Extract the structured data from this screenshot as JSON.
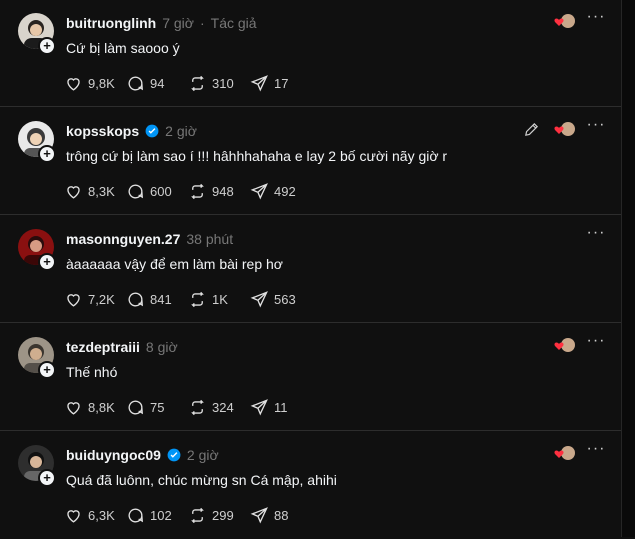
{
  "colors": {
    "background": "#101010",
    "text": "#f3f5f7",
    "muted": "#777777",
    "heart": "#ff3040",
    "verified": "#0095f6"
  },
  "posts": [
    {
      "username": "buitruonglinh",
      "time": "7 giờ",
      "author_tag": "Tác giả",
      "content": "Cứ bị làm saooo ý",
      "likes": "9,8K",
      "comments": "94",
      "reposts": "310",
      "shares": "17",
      "verified": false,
      "has_edit": false,
      "has_like_badge": true
    },
    {
      "username": "kopsskops",
      "time": "2 giờ",
      "author_tag": "",
      "content": "trông cứ bị làm sao í !!! hâhhhahaha e lay 2 bố cười nãy giờ r",
      "likes": "8,3K",
      "comments": "600",
      "reposts": "948",
      "shares": "492",
      "verified": true,
      "has_edit": true,
      "has_like_badge": true
    },
    {
      "username": "masonnguyen.27",
      "time": "38 phút",
      "author_tag": "",
      "content": "àaaaaaa vậy để em làm bài rep hơ",
      "likes": "7,2K",
      "comments": "841",
      "reposts": "1K",
      "shares": "563",
      "verified": false,
      "has_edit": false,
      "has_like_badge": false
    },
    {
      "username": "tezdeptraiii",
      "time": "8 giờ",
      "author_tag": "",
      "content": "Thế nhó",
      "likes": "8,8K",
      "comments": "75",
      "reposts": "324",
      "shares": "11",
      "verified": false,
      "has_edit": false,
      "has_like_badge": true
    },
    {
      "username": "buiduyngoc09",
      "time": "2 giờ",
      "author_tag": "",
      "content": "Quá đã luônn, chúc mừng sn Cá mập, ahihi",
      "likes": "6,3K",
      "comments": "102",
      "reposts": "299",
      "shares": "88",
      "verified": true,
      "has_edit": false,
      "has_like_badge": true
    }
  ]
}
